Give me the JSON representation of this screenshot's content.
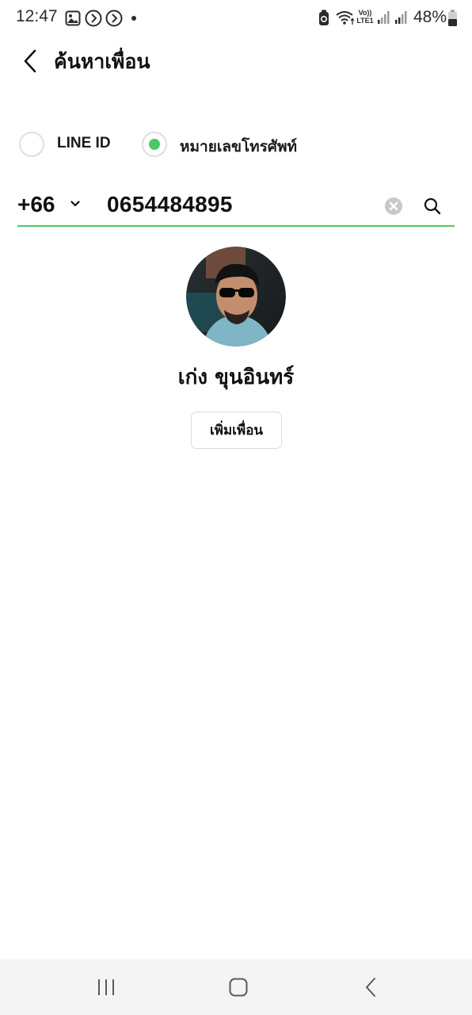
{
  "status_bar": {
    "time": "12:47",
    "network_label_top": "Vo))",
    "network_label_bottom": "LTE1",
    "battery_percent": "48%"
  },
  "header": {
    "title": "ค้นหาเพื่อน"
  },
  "search_type": {
    "options": [
      {
        "label": "LINE ID",
        "selected": false
      },
      {
        "label": "หมายเลขโทรศัพท์",
        "selected": true
      }
    ]
  },
  "phone_input": {
    "country_code": "+66",
    "value": "0654484895"
  },
  "result": {
    "name": "เก่ง ขุนอินทร์",
    "add_button_label": "เพิ่มเพื่อน"
  },
  "colors": {
    "accent": "#4cc764",
    "nav_background": "#f4f4f4"
  }
}
